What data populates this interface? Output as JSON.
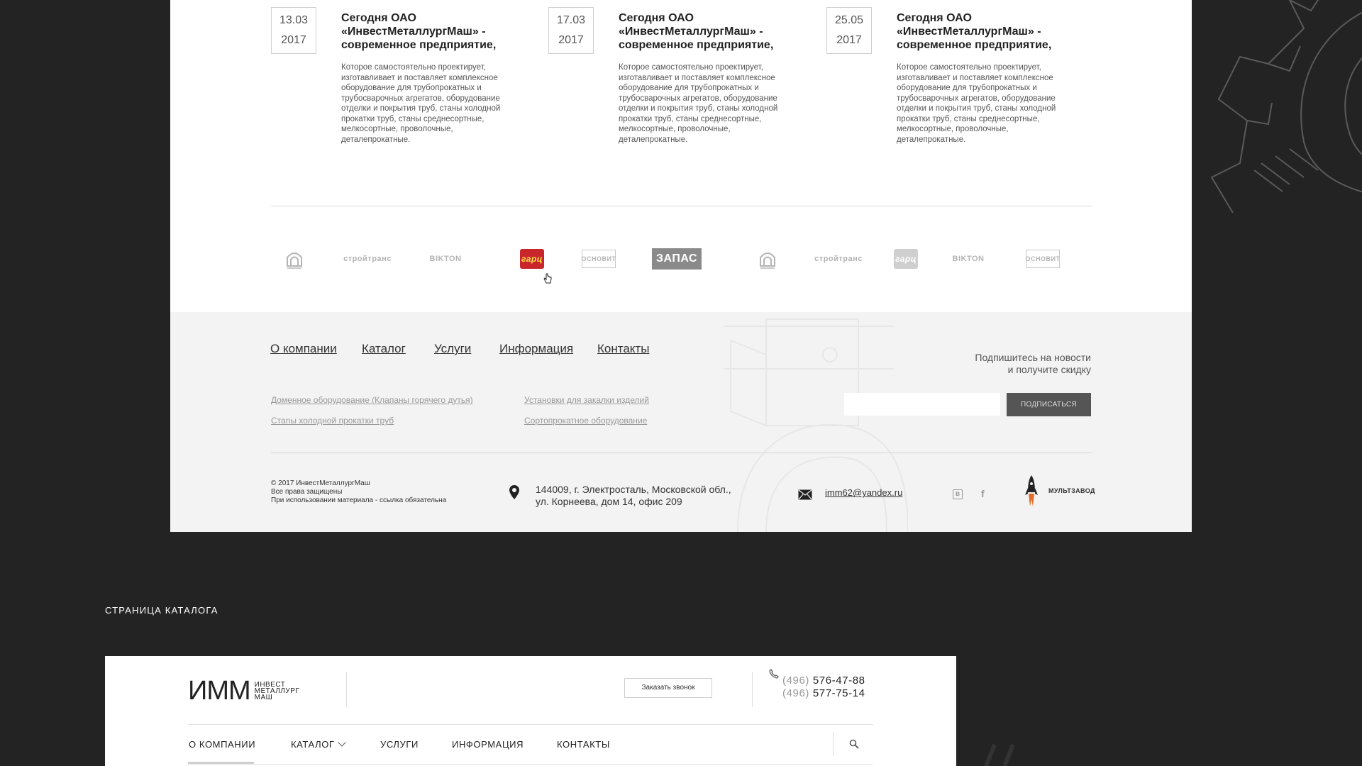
{
  "news": [
    {
      "day": "13.03",
      "year": "2017",
      "title": "Сегодня ОАО «ИнвестМеталлургМаш» - современное предприятие,",
      "text": "Которое самостоятельно проектирует, изготавливает и поставляет комплексное оборудование для трубопрокатных и трубосварочных агрегатов, оборудование отделки и покрытия труб, станы холодной прокатки труб, станы среднесортные, мелкосортные, проволочные, деталепрокатные."
    },
    {
      "day": "17.03",
      "year": "2017",
      "title": "Сегодня ОАО «ИнвестМеталлургМаш» - современное предприятие,",
      "text": "Которое самостоятельно проектирует, изготавливает и поставляет комплексное оборудование для трубопрокатных и трубосварочных агрегатов, оборудование отделки и покрытия труб, станы холодной прокатки труб, станы среднесортные, мелкосортные, проволочные, деталепрокатные."
    },
    {
      "day": "25.05",
      "year": "2017",
      "title": "Сегодня ОАО «ИнвестМеталлургМаш» - современное предприятие,",
      "text": "Которое самостоятельно проектирует, изготавливает и поставляет комплексное оборудование для трубопрокатных и трубосварочных агрегатов, оборудование отделки и покрытия труб, станы холодной прокатки труб, станы среднесортные, мелкосортные, проволочные, деталепрокатные."
    }
  ],
  "partners": [
    "стройтранс",
    "BIKTON",
    "гарц",
    "ОСНОВИТ",
    "ЗАПАС",
    "стройтранс",
    "гарц",
    "BIKTON",
    "ОСНОВИТ"
  ],
  "footer": {
    "nav": [
      "О компании",
      "Каталог",
      "Услуги",
      "Информация",
      "Контакты"
    ],
    "links": [
      "Доменное оборудование (Клапаны горячего дутья)",
      "Стаnы холодной прокатки труб",
      "Установки для закалки изделий",
      "Сортопрокатное оборудование"
    ],
    "subscribe_line1": "Подпишитесь на новости",
    "subscribe_line2": "и получите скидку",
    "subscribe_button": "ПОДПИСАТЬСЯ",
    "copyright1": "© 2017 ИнвестМеталлургМаш",
    "copyright2": "Все права защищены",
    "copyright3": "При использовании материала - ссылка обязательна",
    "address1": "144009, г. Электросталь, Московской обл.,",
    "address2": "ул. Корнеева, дом 14, офис 209",
    "email": "imm62@yandex.ru",
    "vk": "в",
    "fb": "f",
    "developer": "МУЛЬТЗАВОД"
  },
  "section_title": "СТРАНИЦА КАТАЛОГА",
  "preview": {
    "logo_big": "ИММ",
    "logo_small1": "ИНВЕСТ",
    "logo_small2": "МЕТАЛЛУРГ",
    "logo_small3": "МАШ",
    "callback": "Заказать звонок",
    "phone1_code": "(496)",
    "phone1_num": "576-47-88",
    "phone2_code": "(496)",
    "phone2_num": "577-75-14",
    "nav": [
      "О КОМПАНИИ",
      "КАТАЛОГ",
      "УСЛУГИ",
      "ИНФОРМАЦИЯ",
      "КОНТАКТЫ"
    ]
  }
}
